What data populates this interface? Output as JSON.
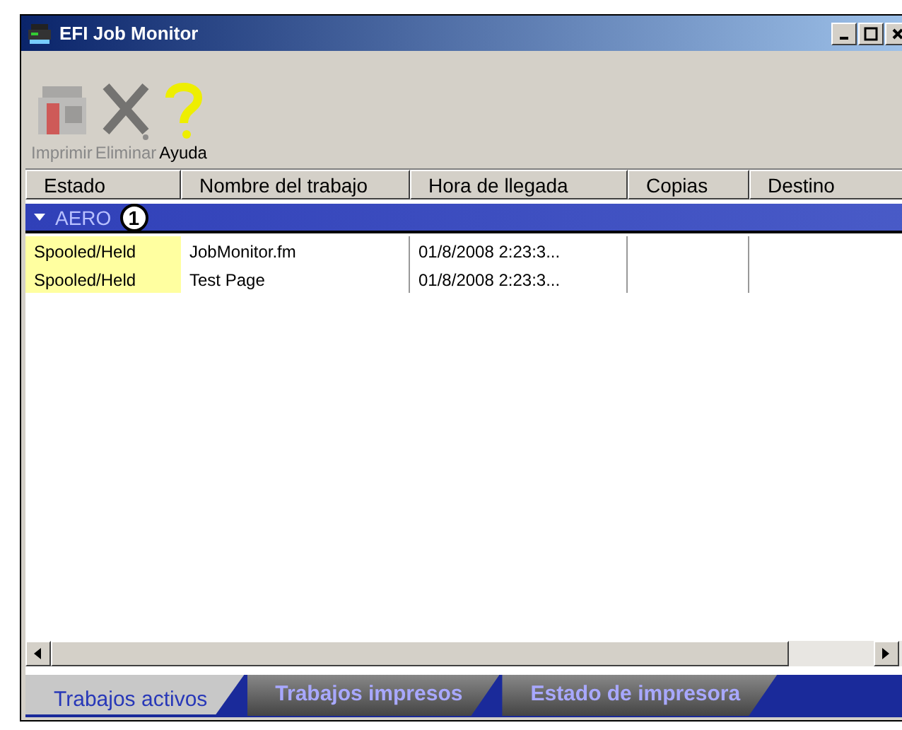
{
  "window": {
    "title": "EFI Job Monitor"
  },
  "toolbar": [
    {
      "label": "Imprimir",
      "kind": "printer",
      "disabled": true
    },
    {
      "label": "Eliminar",
      "kind": "delete",
      "disabled": true
    },
    {
      "label": "Ayuda",
      "kind": "help",
      "disabled": false
    }
  ],
  "table": {
    "columns": [
      "Estado",
      "Nombre del trabajo",
      "Hora de llegada",
      "Copias",
      "Destino"
    ],
    "group": {
      "label": "AERO",
      "expanded": true,
      "callout": "1"
    },
    "rows": [
      [
        "Spooled/Held",
        "JobMonitor.fm",
        "01/8/2008 2:23:3...",
        "",
        ""
      ],
      [
        "Spooled/Held",
        "Test Page",
        "01/8/2008 2:23:3...",
        "",
        ""
      ]
    ]
  },
  "tabs": [
    {
      "label": "Trabajos activos",
      "selected": true
    },
    {
      "label": "Trabajos impresos",
      "selected": false
    },
    {
      "label": "Estado de impresora",
      "selected": false
    }
  ]
}
